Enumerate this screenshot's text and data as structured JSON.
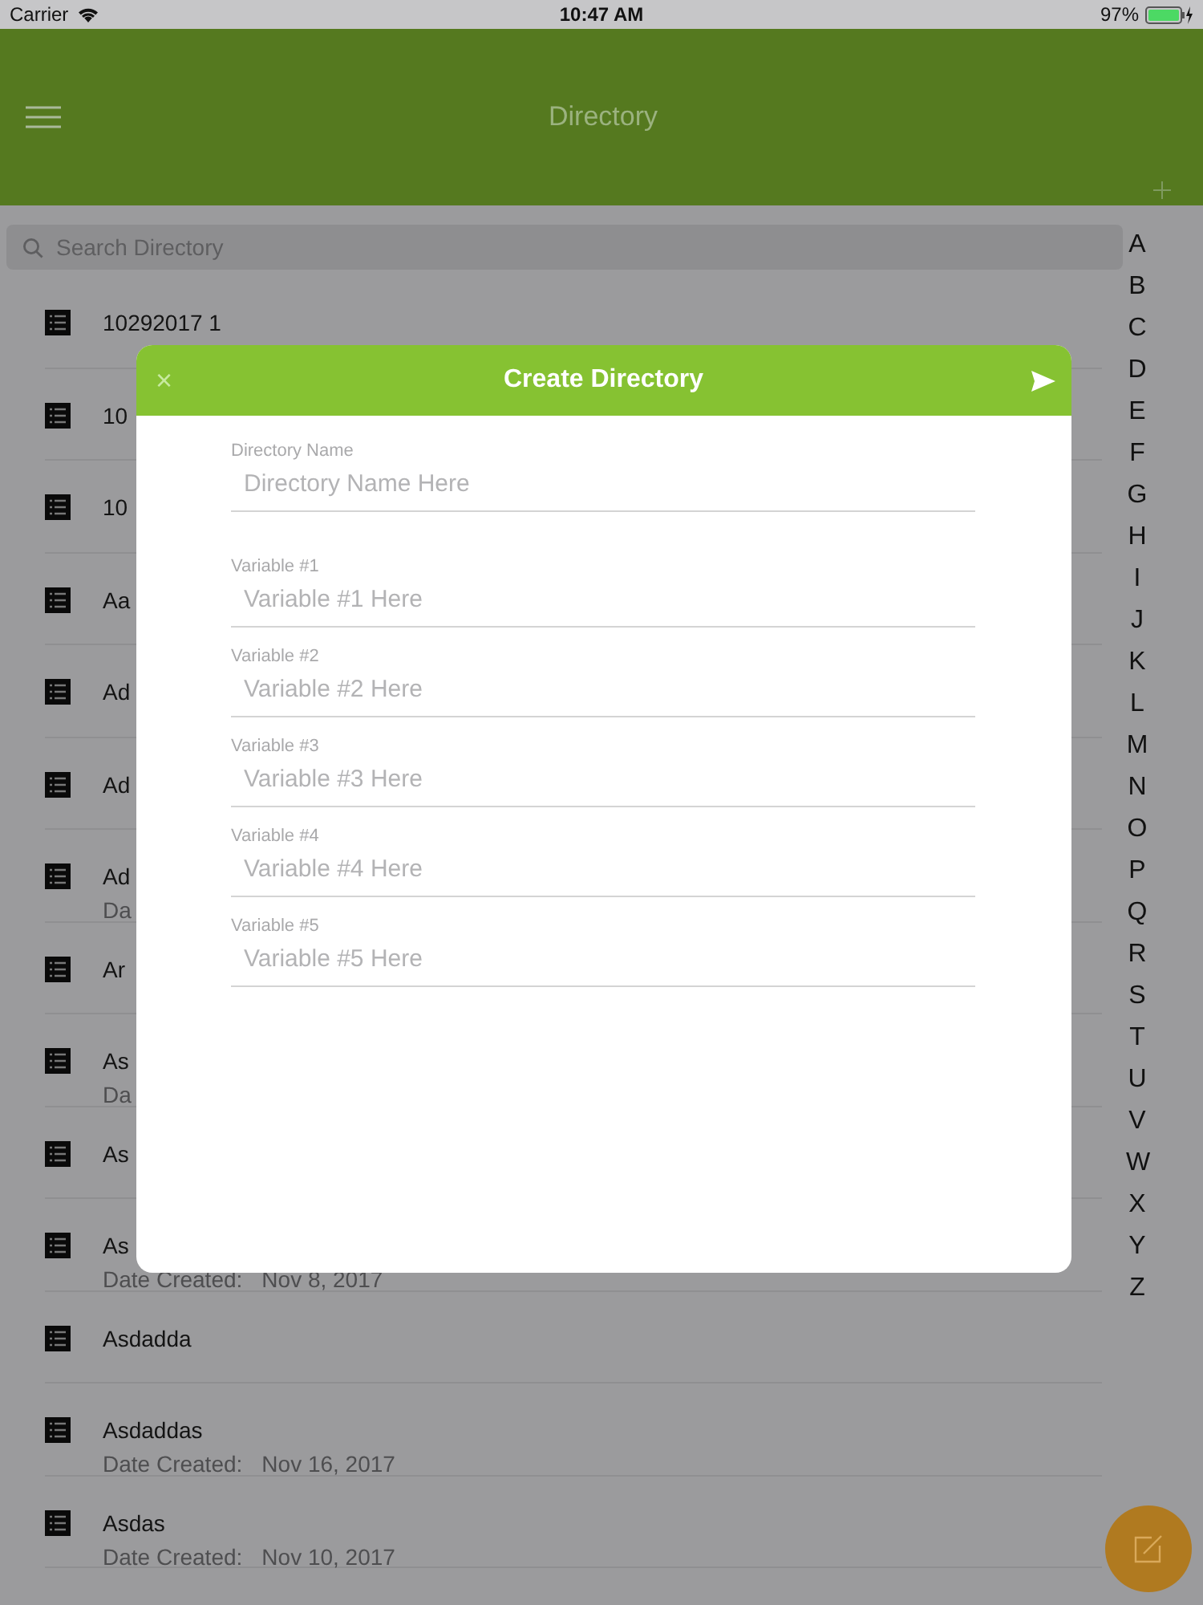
{
  "status_bar": {
    "carrier": "Carrier",
    "time": "10:47 AM",
    "battery": "97%"
  },
  "header": {
    "title": "Directory"
  },
  "search": {
    "placeholder": "Search Directory"
  },
  "rows": [
    {
      "name": "10292017 1"
    },
    {
      "name": "10"
    },
    {
      "name": "10"
    },
    {
      "name": "Aa"
    },
    {
      "name": "Ad"
    },
    {
      "name": "Ad"
    },
    {
      "name": "Ad",
      "date_label": "Da"
    },
    {
      "name": "Ar"
    },
    {
      "name": "As",
      "date_label": "Da"
    },
    {
      "name": "As"
    },
    {
      "name": "As",
      "date_label": "Date Created:",
      "date": "Nov 8, 2017"
    },
    {
      "name": "Asdadda"
    },
    {
      "name": "Asdaddas",
      "date_label": "Date Created:",
      "date": "Nov 16, 2017"
    },
    {
      "name": "Asdas",
      "date_label": "Date Created:",
      "date": "Nov 10, 2017"
    }
  ],
  "index": [
    "A",
    "B",
    "C",
    "D",
    "E",
    "F",
    "G",
    "H",
    "I",
    "J",
    "K",
    "L",
    "M",
    "N",
    "O",
    "P",
    "Q",
    "R",
    "S",
    "T",
    "U",
    "V",
    "W",
    "X",
    "Y",
    "Z"
  ],
  "dialog": {
    "title": "Create Directory",
    "close": "×",
    "fields": [
      {
        "label": "Directory Name",
        "placeholder": "Directory Name Here"
      },
      {
        "label": "Variable #1",
        "placeholder": "Variable #1 Here"
      },
      {
        "label": "Variable #2",
        "placeholder": "Variable #2 Here"
      },
      {
        "label": "Variable #3",
        "placeholder": "Variable #3 Here"
      },
      {
        "label": "Variable #4",
        "placeholder": "Variable #4 Here"
      },
      {
        "label": "Variable #5",
        "placeholder": "Variable #5 Here"
      }
    ]
  }
}
